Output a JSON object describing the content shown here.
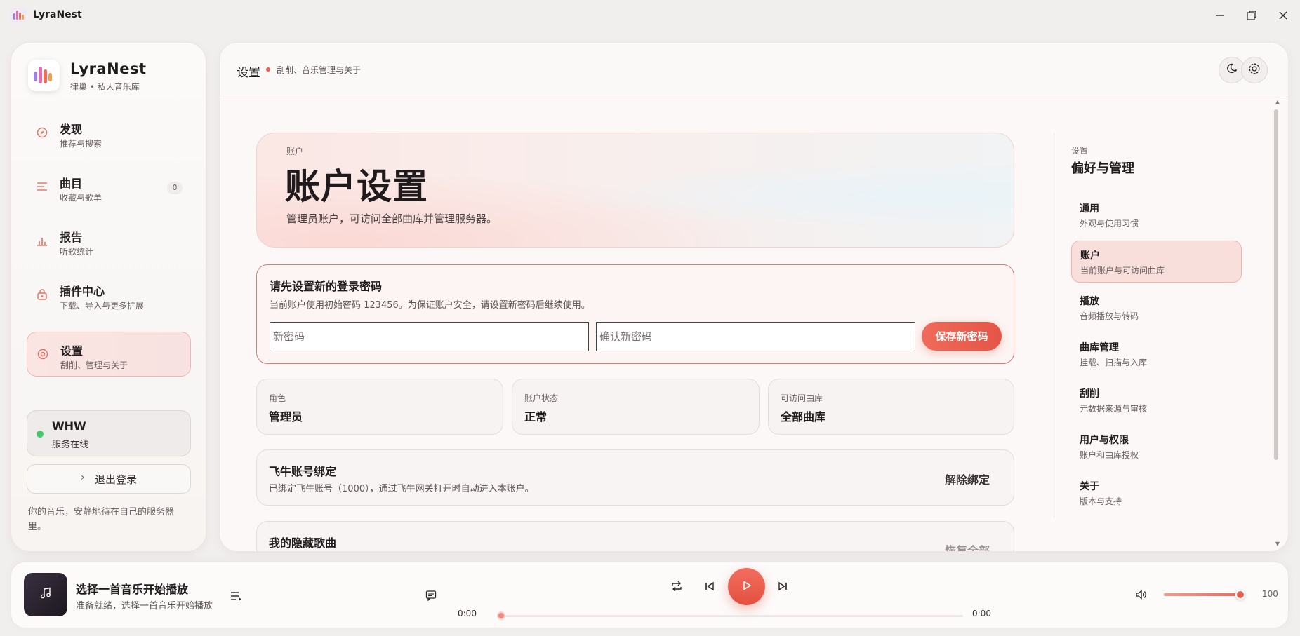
{
  "window": {
    "title": "LyraNest",
    "controls": [
      "minimize-icon",
      "maximize-icon",
      "close-icon"
    ]
  },
  "colors": {
    "accent": "#ee5b4f",
    "accent_soft": "#fbe5e2",
    "online": "#44c86b"
  },
  "sidebar": {
    "brand_title": "LyraNest",
    "brand_subtitle": "律巢 • 私人音乐库",
    "items": [
      {
        "label": "发现",
        "sub": "推荐与搜索",
        "icon": "compass-icon"
      },
      {
        "label": "曲目",
        "sub": "收藏与歌单",
        "icon": "list-icon",
        "badge": "0"
      },
      {
        "label": "报告",
        "sub": "听歌统计",
        "icon": "bar-chart-icon"
      },
      {
        "label": "插件中心",
        "sub": "下载、导入与更多扩展",
        "icon": "puzzle-lock-icon"
      },
      {
        "label": "设置",
        "sub": "刮削、管理与关于",
        "icon": "settings-ring-icon",
        "active": true
      }
    ],
    "server": {
      "name": "WHW",
      "status": "服务在线"
    },
    "logout_label": "退出登录",
    "footer_note": "你的音乐，安静地待在自己的服务器里。"
  },
  "header": {
    "title": "设置",
    "subtitle": "刮削、音乐管理与关于",
    "buttons": [
      "moon-icon",
      "gear-icon"
    ]
  },
  "hero": {
    "kicker": "账户",
    "title": "账户设置",
    "description": "管理员账户，可访问全部曲库并管理服务器。"
  },
  "password_card": {
    "title": "请先设置新的登录密码",
    "description": "当前账户使用初始密码 123456。为保证账户安全，请设置新密码后继续使用。",
    "new_password_placeholder": "新密码",
    "confirm_password_placeholder": "确认新密码",
    "save_label": "保存新密码"
  },
  "info_cards": [
    {
      "label": "角色",
      "value": "管理员"
    },
    {
      "label": "账户状态",
      "value": "正常"
    },
    {
      "label": "可访问曲库",
      "value": "全部曲库"
    }
  ],
  "feiniu_card": {
    "title": "飞牛账号绑定",
    "description": "已绑定飞牛账号（1000），通过飞牛网关打开时自动进入本账户。",
    "action": "解除绑定"
  },
  "hidden_songs_card": {
    "title": "我的隐藏歌曲",
    "action": "恢复全部"
  },
  "settings_nav": {
    "kicker": "设置",
    "title": "偏好与管理",
    "items": [
      {
        "label": "通用",
        "sub": "外观与使用习惯"
      },
      {
        "label": "账户",
        "sub": "当前账户与可访问曲库",
        "active": true
      },
      {
        "label": "播放",
        "sub": "音频播放与转码"
      },
      {
        "label": "曲库管理",
        "sub": "挂载、扫描与入库"
      },
      {
        "label": "刮削",
        "sub": "元数据来源与审核"
      },
      {
        "label": "用户与权限",
        "sub": "账户和曲库授权"
      },
      {
        "label": "关于",
        "sub": "版本与支持"
      }
    ]
  },
  "player": {
    "cover_icon": "music-note-icon",
    "title": "选择一首音乐开始播放",
    "subtitle": "准备就绪，选择一首音乐开始播放",
    "time_current": "0:00",
    "time_total": "0:00",
    "progress": 0,
    "volume": 100,
    "volume_label": "100",
    "icons": [
      "queue-icon",
      "lyrics-icon",
      "repeat-icon",
      "previous-icon",
      "play-icon",
      "next-icon",
      "volume-icon"
    ]
  }
}
